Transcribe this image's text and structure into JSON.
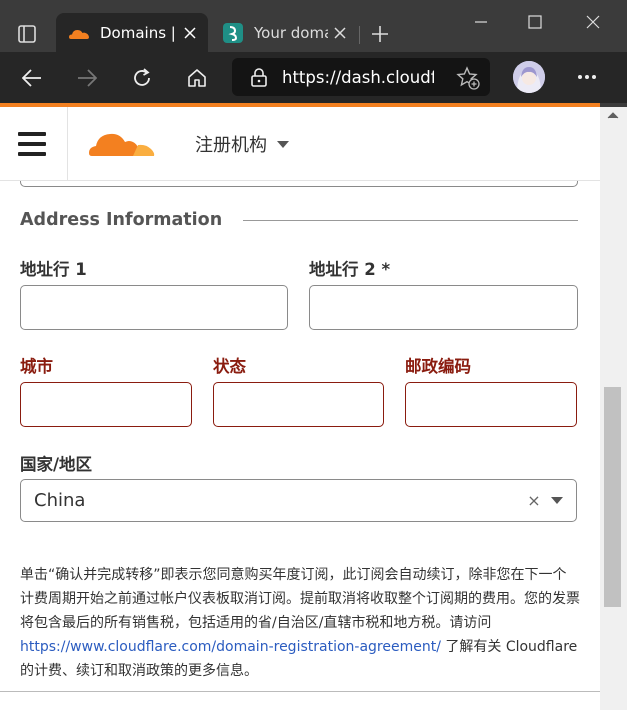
{
  "browser": {
    "tabs": [
      {
        "title": "Domains | ",
        "favicon": "cloudflare-icon",
        "active": true
      },
      {
        "title": "Your doma",
        "favicon": "domain-icon",
        "active": false
      }
    ],
    "url": "https://dash.cloudflare.com/",
    "colors": {
      "accent": "#f38020",
      "tabbar": "#3b3b3b",
      "toolbar": "#262626"
    }
  },
  "header": {
    "registrar_label": "注册机构"
  },
  "address": {
    "section_title": "Address Information",
    "address1_label": "地址行 1",
    "address2_label": "地址行 2 *",
    "city_label": "城市",
    "state_label": "状态",
    "zip_label": "邮政编码",
    "country_label": "国家/地区",
    "country_value": "China",
    "clear_symbol": "×",
    "error_color": "#8a1c0f"
  },
  "legal": {
    "text_1": "单击“确认并完成转移”即表示您同意购买年度订阅，此订阅会自动续订，除非您在下一个计费周期开始之前通过帐户仪表板取消订阅。提前取消将收取整个订阅期的费用。您的发票将包含最后的所有销售税，包括适用的省/自治区/直辖市税和地方税。请访问 ",
    "link": "https://www.cloudflare.com/domain-registration-agreement/",
    "text_2": " 了解有关 Cloudflare 的计费、续订和取消政策的更多信息。"
  }
}
